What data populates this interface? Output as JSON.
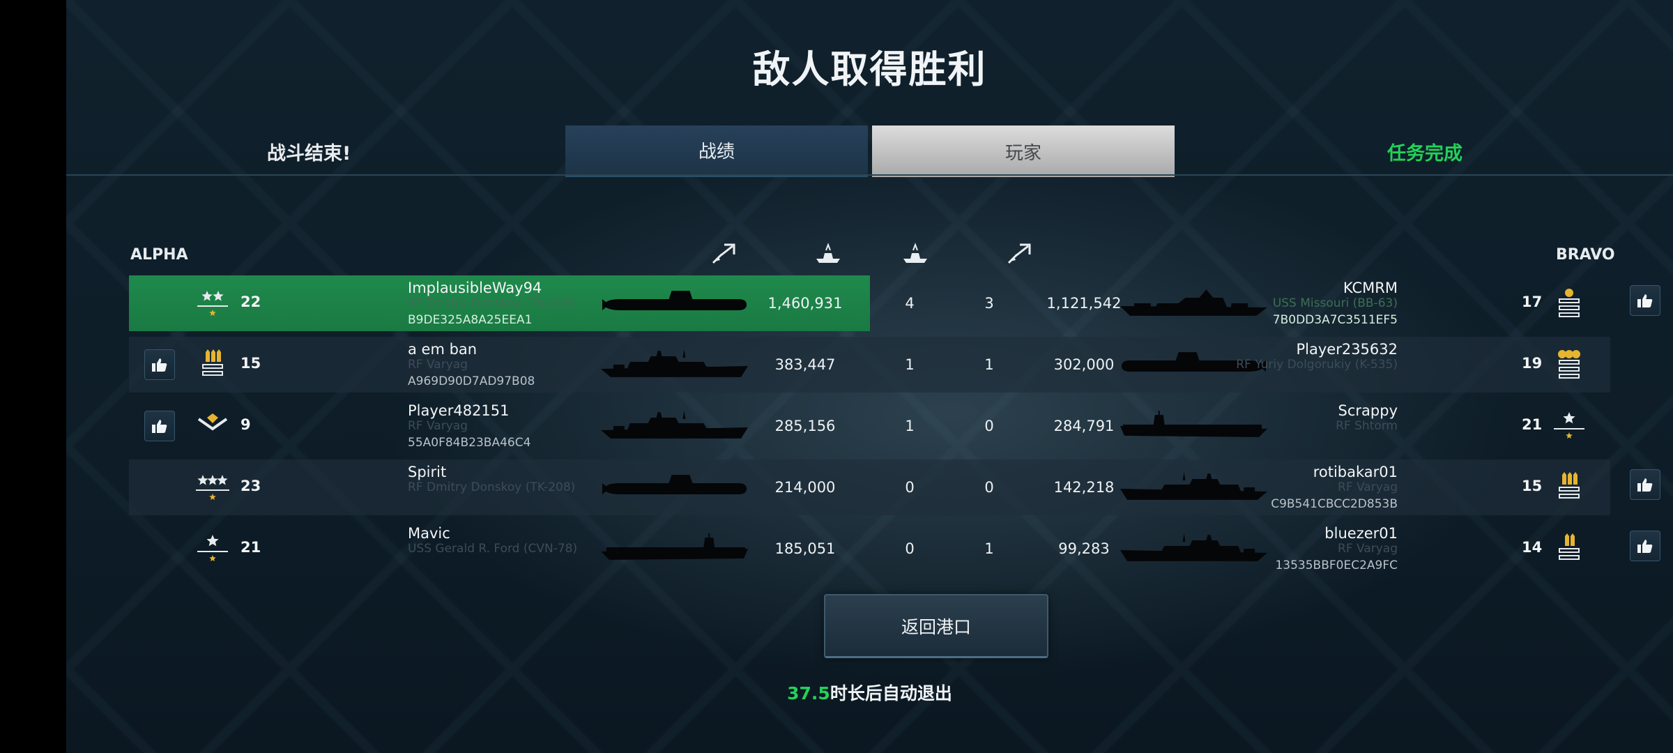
{
  "header": {
    "title": "敌人取得胜利",
    "left_status": "战斗结束!",
    "right_status": "任务完成",
    "tabs": [
      {
        "label": "战绩",
        "active": false
      },
      {
        "label": "玩家",
        "active": true
      }
    ]
  },
  "teams": {
    "left": "ALPHA",
    "right": "BRAVO"
  },
  "column_icons": [
    "damage-icon",
    "ships-sunk-icon",
    "ships-sunk-icon",
    "damage-icon"
  ],
  "alpha": [
    {
      "rank_icon": "rank-two-stars-icon",
      "level": "22",
      "name": "ImplausibleWay94",
      "ship": "RF Dmitry Donskoy (TK-208)",
      "uid": "B9DE325A8A25EEA1",
      "ship_type": "submarine",
      "damage": "1,460,931",
      "kills": "4",
      "liked": false,
      "highlight": true
    },
    {
      "rank_icon": "rank-three-pips-icon",
      "level": "15",
      "name": "a em ban",
      "ship": "RF Varyag",
      "uid": "A969D90D7AD97B08",
      "ship_type": "cruiser",
      "damage": "383,447",
      "kills": "1",
      "liked": true
    },
    {
      "rank_icon": "rank-chevron-icon",
      "level": "9",
      "name": "Player482151",
      "ship": "RF Varyag",
      "uid": "55A0F84B23BA46C4",
      "ship_type": "cruiser",
      "damage": "285,156",
      "kills": "1",
      "liked": true
    },
    {
      "rank_icon": "rank-three-stars-icon",
      "level": "23",
      "name": "Spirit",
      "ship": "RF Dmitry Donskoy (TK-208)",
      "uid": "",
      "ship_type": "submarine",
      "damage": "214,000",
      "kills": "0",
      "liked": false
    },
    {
      "rank_icon": "rank-one-star-icon",
      "level": "21",
      "name": "Mavic",
      "ship": "USS Gerald R. Ford (CVN-78)",
      "uid": "",
      "ship_type": "carrier",
      "damage": "185,051",
      "kills": "0",
      "liked": false
    }
  ],
  "bravo": [
    {
      "rank_icon": "rank-gold-bars-icon",
      "level": "17",
      "name": "KCMRM",
      "ship": "USS Missouri (BB-63)",
      "uid": "7B0DD3A7C3511EF5",
      "ship_type": "battleship",
      "damage": "1,121,542",
      "kills": "3",
      "liked": true
    },
    {
      "rank_icon": "rank-gold-three-bars-icon",
      "level": "19",
      "name": "Player235632",
      "ship": "RF Yuriy Dolgorukiy (K-535)",
      "uid": "",
      "ship_type": "submarine",
      "damage": "302,000",
      "kills": "1",
      "liked": false
    },
    {
      "rank_icon": "rank-one-star-icon",
      "level": "21",
      "name": "Scrappy",
      "ship": "RF Shtorm",
      "uid": "",
      "ship_type": "carrier",
      "damage": "284,791",
      "kills": "0",
      "liked": false
    },
    {
      "rank_icon": "rank-three-pips-icon",
      "level": "15",
      "name": "rotibakar01",
      "ship": "RF Varyag",
      "uid": "C9B541CBCC2D853B",
      "ship_type": "cruiser",
      "damage": "142,218",
      "kills": "0",
      "liked": true
    },
    {
      "rank_icon": "rank-two-pips-icon",
      "level": "14",
      "name": "bluezer01",
      "ship": "RF Varyag",
      "uid": "13535BBF0EC2A9FC",
      "ship_type": "cruiser",
      "damage": "99,283",
      "kills": "1",
      "liked": true
    }
  ],
  "footer": {
    "return_button": "返回港口",
    "countdown": "37.5",
    "auto_exit_suffix": "时长后自动退出"
  },
  "colors": {
    "accent_green": "#24d05a",
    "highlight_row": "#1f8a4c"
  }
}
